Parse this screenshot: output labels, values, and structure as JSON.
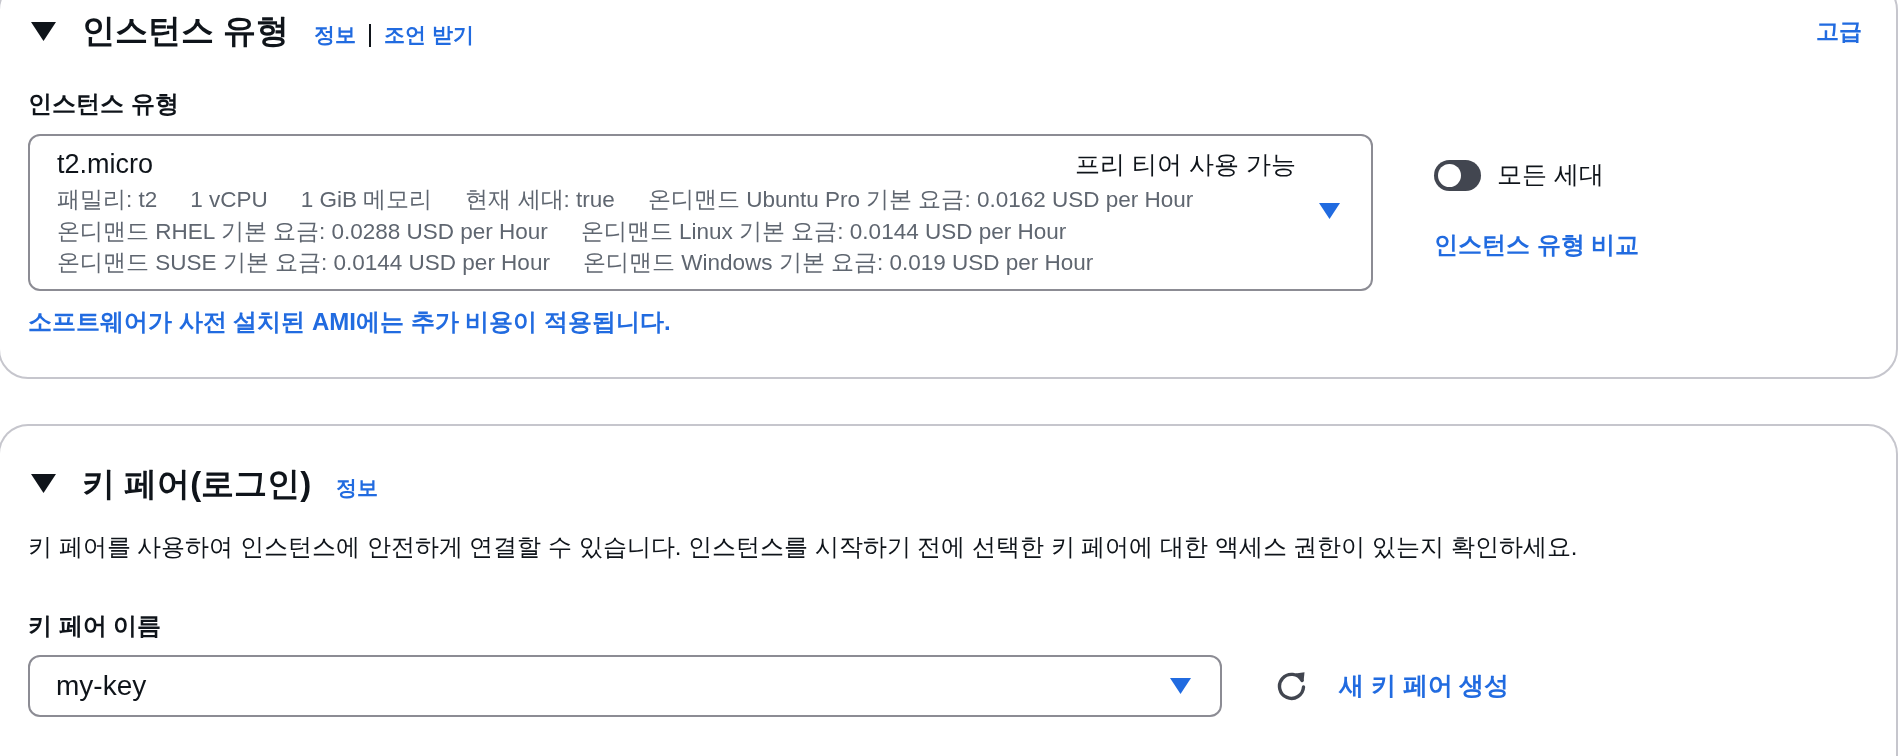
{
  "instance_type": {
    "expanded": true,
    "title": "인스턴스 유형",
    "info_link": "정보",
    "advice_link": "조언 받기",
    "advanced_link": "고급",
    "field_label": "인스턴스 유형",
    "select": {
      "name": "t2.micro",
      "badge": "프리 티어 사용 가능",
      "detail_rows": [
        [
          "패밀리: t2",
          "1 vCPU",
          "1 GiB 메모리",
          "현재 세대: true",
          "온디맨드 Ubuntu Pro 기본 요금: 0.0162 USD per Hour"
        ],
        [
          "온디맨드 RHEL 기본 요금: 0.0288 USD per Hour",
          "온디맨드 Linux 기본 요금: 0.0144 USD per Hour"
        ],
        [
          "온디맨드 SUSE 기본 요금: 0.0144 USD per Hour",
          "온디맨드 Windows 기본 요금: 0.019 USD per Hour"
        ]
      ]
    },
    "all_generations": {
      "label": "모든 세대",
      "on": false
    },
    "compare_link": "인스턴스 유형 비교",
    "note_link": "소프트웨어가 사전 설치된 AMI에는 추가 비용이 적용됩니다."
  },
  "key_pair": {
    "expanded": true,
    "title": "키 페어(로그인)",
    "info_link": "정보",
    "description": "키 페어를 사용하여 인스턴스에 안전하게 연결할 수 있습니다. 인스턴스를 시작하기 전에 선택한 키 페어에 대한 액세스 권한이 있는지 확인하세요.",
    "field_label": "키 페어 이름",
    "select": {
      "value": "my-key"
    },
    "create_link": "새 키 페어 생성"
  }
}
